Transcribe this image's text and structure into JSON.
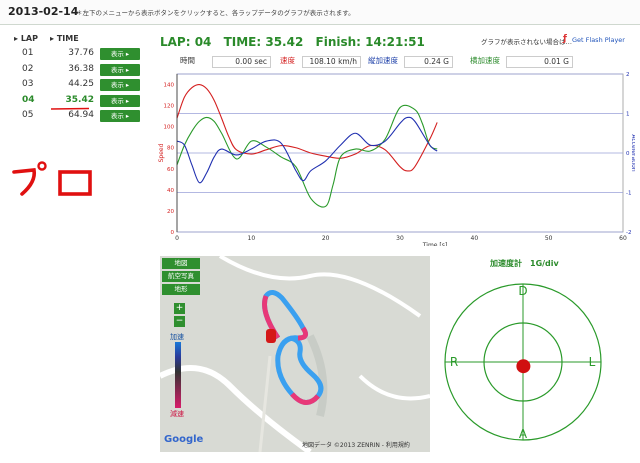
{
  "date": "2013-02-14",
  "notice": "＊左下のメニューから表示ボタンをクリックすると、各ラップデータのグラフが表示されます。",
  "lap_table": {
    "col_lap": "LAP",
    "col_time": "TIME",
    "button_label": "表示",
    "rows": [
      {
        "lap": "01",
        "time": "37.76"
      },
      {
        "lap": "02",
        "time": "36.38"
      },
      {
        "lap": "03",
        "time": "44.25"
      },
      {
        "lap": "04",
        "time": "35.42"
      },
      {
        "lap": "05",
        "time": "64.94"
      }
    ],
    "current_index": 3
  },
  "annotation": "プロ",
  "header": {
    "lap": "LAP: 04",
    "time": "TIME: 35.42",
    "finish": "Finish: 14:21:51"
  },
  "flash": {
    "note": "グラフが表示されない場合は…",
    "link": "Get Flash Player"
  },
  "readouts": {
    "time_label": "時間",
    "time_value": "0.00 sec",
    "speed_label": "速度",
    "speed_value": "108.10 km/h",
    "long_label": "縦加速度",
    "long_value": "0.24 G",
    "lat_label": "横加速度",
    "lat_value": "0.01 G"
  },
  "chart_data": {
    "type": "line",
    "xlabel": "Time [s]",
    "ylabel_left": "Speed",
    "ylabel_right": "Acceleration",
    "xlim": [
      0,
      60
    ],
    "ylim_left": [
      0,
      150
    ],
    "ylim_right": [
      -2,
      2
    ],
    "xticks": [
      0,
      10,
      20,
      30,
      40,
      50,
      60
    ],
    "yticks_left": [
      0,
      20,
      40,
      60,
      80,
      100,
      120,
      140
    ],
    "yticks_right": [
      -2,
      -1,
      0,
      1,
      2
    ],
    "colors": {
      "speed": "#d42020",
      "long": "#2a9a2a",
      "lat": "#2030b0"
    },
    "series": [
      {
        "key": "speed",
        "axis": "left",
        "x": [
          0,
          1,
          2,
          3,
          4,
          5,
          6,
          7,
          8,
          10,
          12,
          14,
          16,
          18,
          20,
          22,
          24,
          26,
          28,
          30,
          31,
          32,
          34,
          35
        ],
        "values": [
          108,
          128,
          137,
          140,
          136,
          125,
          108,
          90,
          78,
          74,
          78,
          82,
          80,
          75,
          72,
          70,
          74,
          82,
          78,
          62,
          58,
          62,
          88,
          104
        ]
      },
      {
        "key": "long",
        "axis": "right",
        "x": [
          0,
          1,
          2,
          3,
          4,
          5,
          6,
          8,
          10,
          12,
          14,
          16,
          18,
          20,
          21,
          22,
          24,
          26,
          28,
          30,
          32,
          33,
          34,
          35
        ],
        "values": [
          -0.3,
          0.2,
          0.55,
          0.8,
          0.9,
          0.8,
          0.5,
          -0.15,
          0.3,
          0.15,
          -0.1,
          -0.35,
          -1.15,
          -1.35,
          -0.8,
          -0.1,
          0.1,
          0.05,
          0.35,
          1.15,
          1.1,
          0.75,
          0.2,
          0.1
        ]
      },
      {
        "key": "lat",
        "axis": "right",
        "x": [
          0,
          1,
          2,
          3,
          4,
          5,
          6,
          8,
          10,
          12,
          14,
          16,
          17,
          18,
          20,
          22,
          24,
          26,
          28,
          30,
          31,
          32,
          34,
          35
        ],
        "values": [
          0.3,
          0.2,
          -0.3,
          -0.75,
          -0.5,
          -0.1,
          0.1,
          -0.05,
          0.1,
          0.3,
          0.25,
          -0.45,
          -0.7,
          -0.45,
          -0.2,
          0.2,
          0.5,
          0.2,
          0.3,
          0.75,
          0.9,
          0.8,
          0.2,
          0.05
        ]
      }
    ]
  },
  "map": {
    "btn_map": "地図",
    "btn_aerial": "航空写真",
    "btn_terrain": "地形",
    "zoom_in": "+",
    "zoom_out": "−",
    "accel": "加速",
    "decel": "減速",
    "copyright": "地図データ ©2013 ZENRIN - 利用規約",
    "logo": "Google"
  },
  "gmeter": {
    "title": "加速度計　1G/div",
    "top": "D",
    "bottom": "A",
    "left": "R",
    "right": "L",
    "dot_color": "#d01010"
  }
}
